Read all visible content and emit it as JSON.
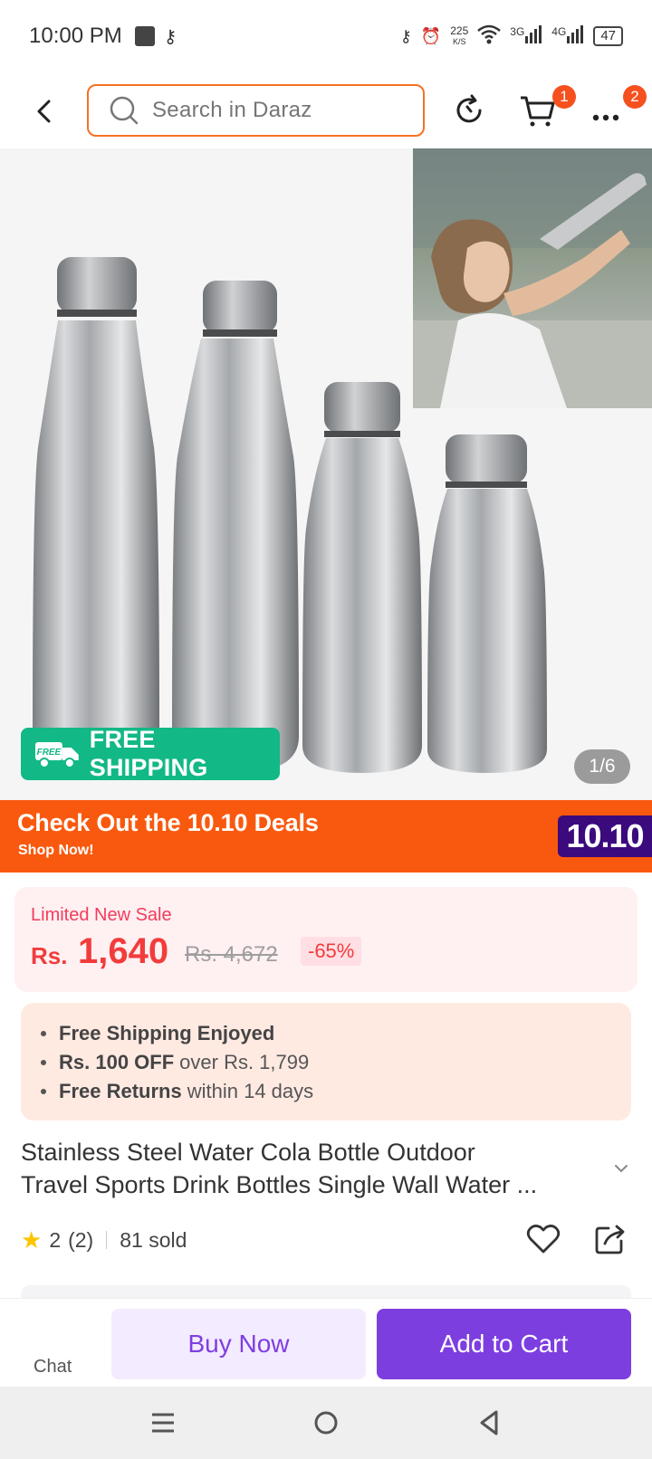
{
  "status_bar": {
    "time": "10:00 PM",
    "net_speed_value": "225",
    "net_speed_unit": "K/S",
    "sig1": "3G",
    "sig2": "4G",
    "battery": "47"
  },
  "header": {
    "search_placeholder": "Search in Daraz",
    "cart_badge": "1",
    "more_badge": "2"
  },
  "gallery": {
    "free_shipping_tag": "FREE",
    "free_shipping_label": "FREE SHIPPING",
    "pager": "1/6"
  },
  "banner": {
    "title": "Check Out the 10.10 Deals",
    "subtitle": "Shop Now!",
    "logo": "10.10"
  },
  "price": {
    "label": "Limited New Sale",
    "currency": "Rs.",
    "current": "1,640",
    "original": "Rs. 4,672",
    "discount": "-65%"
  },
  "benefits": [
    {
      "bold": "Free Shipping Enjoyed",
      "rest": ""
    },
    {
      "bold": "Rs. 100 OFF",
      "rest": "over Rs. 1,799"
    },
    {
      "bold": "Free Returns",
      "rest": "within 14 days"
    }
  ],
  "product": {
    "title_line1": "Stainless Steel Water Cola Bottle Outdoor",
    "title_line2": "Travel Sports Drink Bottles Single Wall Water ...",
    "rating": "2",
    "reviews": "(2)",
    "sold": "81 sold"
  },
  "actions": {
    "chat": "Chat",
    "buy_now": "Buy Now",
    "add_to_cart": "Add to Cart"
  },
  "colors": {
    "brand_orange": "#f57224",
    "price_red": "#f23c3c",
    "purple": "#7d3ee0",
    "free_ship_green": "#12b886"
  }
}
